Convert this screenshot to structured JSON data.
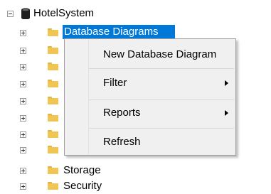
{
  "tree": {
    "root_label": "HotelSystem",
    "selected_label": "Database Diagrams",
    "bottom_items": [
      "Storage",
      "Security"
    ]
  },
  "context_menu": {
    "items": [
      {
        "label": "New Database Diagram",
        "submenu": false
      },
      {
        "label": "Filter",
        "submenu": true
      },
      {
        "label": "Reports",
        "submenu": true
      },
      {
        "label": "Refresh",
        "submenu": false
      }
    ]
  },
  "colors": {
    "selection": "#0078d7",
    "folder": "#f1c553",
    "menu_background": "#f0f0f0"
  },
  "icons": {
    "expander_collapsed": "plus-box-icon",
    "expander_expanded": "minus-box-icon",
    "database": "database-icon",
    "folder": "folder-icon",
    "submenu": "chevron-right-icon"
  }
}
